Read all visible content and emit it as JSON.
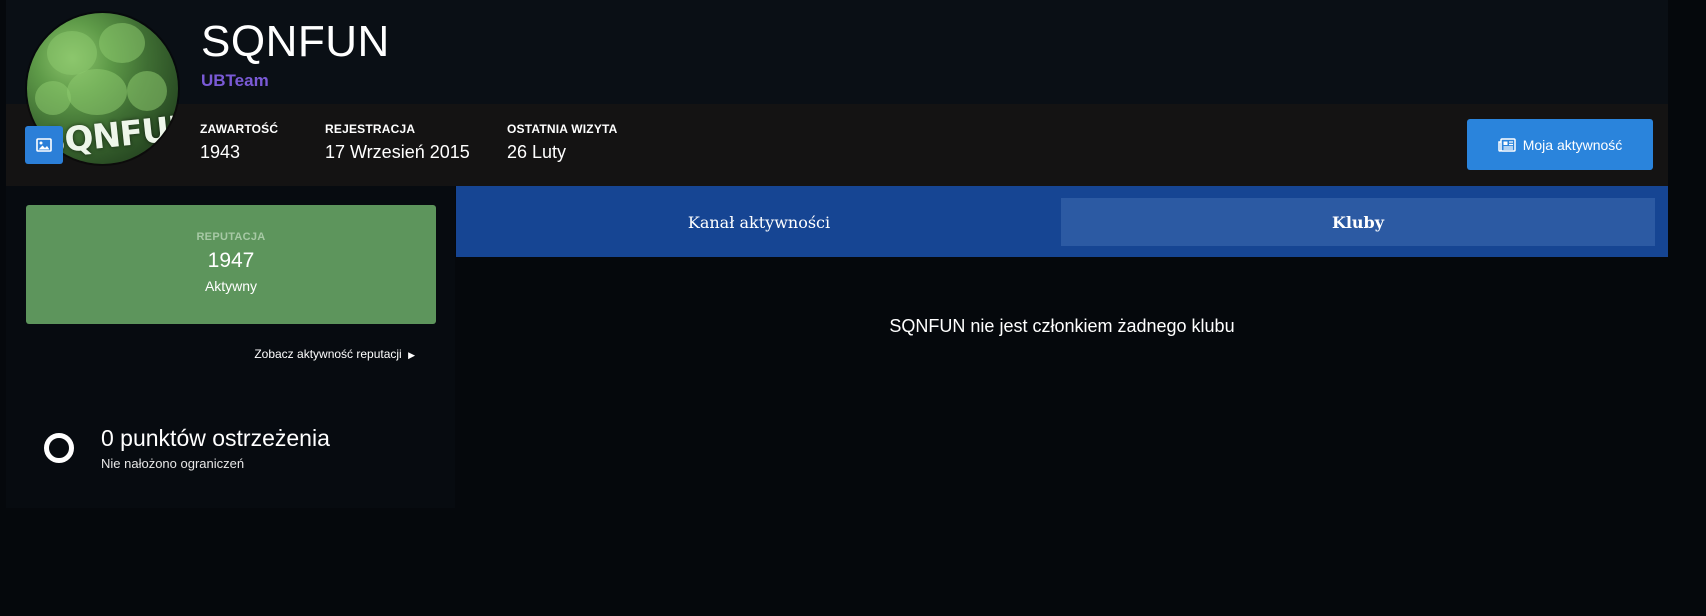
{
  "profile": {
    "username": "SQNFUN",
    "group": "UBTeam",
    "avatar_text": "SQNFUN",
    "group_color": "#7a5ad6"
  },
  "stats": [
    {
      "label": "ZAWARTOŚĆ",
      "value": "1943"
    },
    {
      "label": "REJESTRACJA",
      "value": "17 Wrzesień 2015"
    },
    {
      "label": "OSTATNIA WIZYTA",
      "value": "26 Luty"
    }
  ],
  "header": {
    "activity_button": "Moja aktywność",
    "activity_icon": "newspaper-icon",
    "avatar_edit_icon": "image-icon"
  },
  "reputation": {
    "label": "REPUTACJA",
    "value": "1947",
    "status": "Aktywny",
    "link": "Zobacz aktywność reputacji",
    "box_color": "#5d955c"
  },
  "warnings": {
    "title": "0 punktów ostrzeżenia",
    "subtitle": "Nie nałożono ograniczeń"
  },
  "tabs": [
    {
      "label": "Kanał aktywności",
      "active": false
    },
    {
      "label": "Kluby",
      "active": true
    }
  ],
  "content": {
    "empty_message": "SQNFUN nie jest członkiem żadnego klubu"
  },
  "colors": {
    "accent": "#2a84dc",
    "tab_bar": "#164593",
    "tab_active": "#2c5aa3",
    "background": "#05080c"
  }
}
